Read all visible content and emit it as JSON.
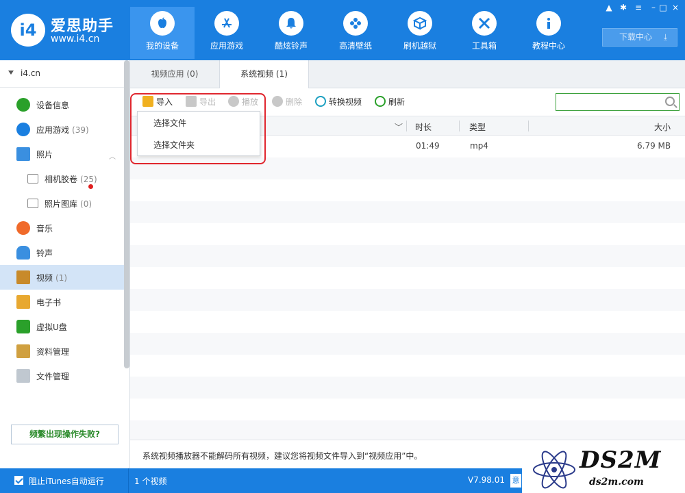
{
  "app": {
    "name": "爱思助手",
    "site": "www.i4.cn",
    "logo_text": "i4"
  },
  "nav": [
    {
      "label": "我的设备",
      "icon": "apple-icon",
      "active": true
    },
    {
      "label": "应用游戏",
      "icon": "app-store-icon"
    },
    {
      "label": "酷炫铃声",
      "icon": "bell-icon"
    },
    {
      "label": "高清壁纸",
      "icon": "flower-icon"
    },
    {
      "label": "刷机越狱",
      "icon": "box-icon"
    },
    {
      "label": "工具箱",
      "icon": "tools-icon"
    },
    {
      "label": "教程中心",
      "icon": "info-icon"
    }
  ],
  "download_center": "下载中心",
  "device": {
    "name": "i4.cn"
  },
  "sidebar": {
    "items": [
      {
        "label": "设备信息",
        "count": "",
        "icon": "info-icon",
        "color": "#2aa02a"
      },
      {
        "label": "应用游戏",
        "count": "(39)",
        "icon": "app-store-icon",
        "color": "#1a7fe0"
      },
      {
        "label": "照片",
        "count": "",
        "icon": "photo-icon",
        "color": "#3a8fe0"
      },
      {
        "label": "相机胶卷",
        "count": "(25)",
        "icon": "folder-icon",
        "sub": true
      },
      {
        "label": "照片图库",
        "count": "(0)",
        "icon": "folder-icon",
        "sub": true
      },
      {
        "label": "音乐",
        "count": "",
        "icon": "music-icon",
        "color": "#f06a2a"
      },
      {
        "label": "铃声",
        "count": "",
        "icon": "bell-icon",
        "color": "#3a8fe0"
      },
      {
        "label": "视频",
        "count": "(1)",
        "icon": "film-icon",
        "color": "#c88a2a",
        "active": true
      },
      {
        "label": "电子书",
        "count": "",
        "icon": "book-icon",
        "color": "#e8a830"
      },
      {
        "label": "虚拟U盘",
        "count": "",
        "icon": "usb-icon",
        "color": "#2aa02a"
      },
      {
        "label": "资料管理",
        "count": "",
        "icon": "contacts-icon",
        "color": "#d0a040"
      },
      {
        "label": "文件管理",
        "count": "",
        "icon": "file-icon",
        "color": "#c0c8d0"
      }
    ],
    "help_button": "频繁出现操作失败?"
  },
  "tabs": [
    {
      "label": "视频应用 (0)"
    },
    {
      "label": "系统视频 (1)",
      "active": true
    }
  ],
  "toolbar": {
    "import": "导入",
    "export": "导出",
    "play": "播放",
    "delete": "删除",
    "convert": "转换视频",
    "refresh": "刷新"
  },
  "search": {
    "placeholder": ""
  },
  "dropdown": {
    "items": [
      "选择文件",
      "选择文件夹"
    ]
  },
  "table": {
    "columns": [
      "时长",
      "类型",
      "大小"
    ],
    "rows": [
      {
        "duration": "01:49",
        "type": "mp4",
        "size": "6.79 MB"
      }
    ]
  },
  "hint": "系统视频播放器不能解码所有视频，建议您将视频文件导入到“视频应用”中。",
  "status": {
    "itunes_block": "阻止iTunes自动运行",
    "count": "1 个视频",
    "version": "V7.98.01",
    "feedback": "意"
  },
  "watermark": {
    "big": "DS2M",
    "small": "ds2m.com"
  },
  "colors": {
    "brand": "#1a7fe0",
    "highlight": "#e0262e",
    "active_row": "#d3e4f7"
  }
}
